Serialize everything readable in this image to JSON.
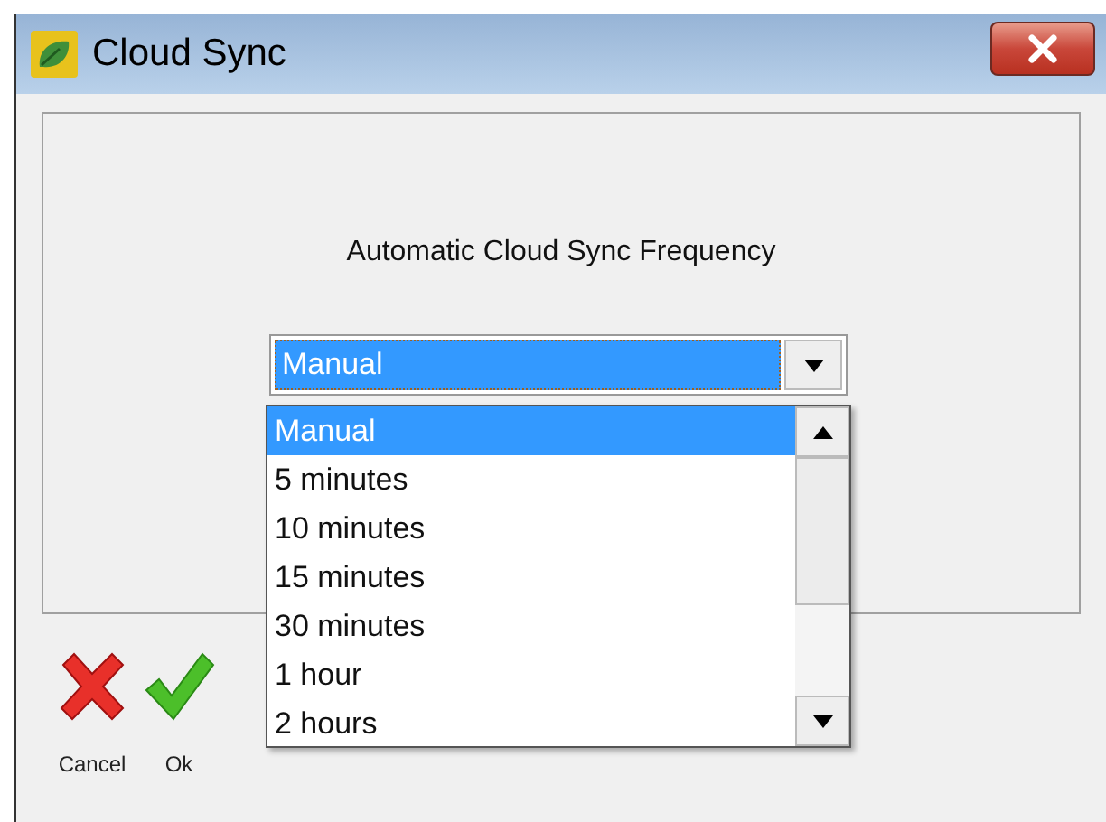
{
  "window": {
    "title": "Cloud Sync"
  },
  "frequency": {
    "label": "Automatic Cloud Sync Frequency",
    "value": "Manual",
    "expanded": true,
    "options": [
      {
        "label": "Manual",
        "selected": true
      },
      {
        "label": "5 minutes",
        "selected": false
      },
      {
        "label": "10 minutes",
        "selected": false
      },
      {
        "label": "15 minutes",
        "selected": false
      },
      {
        "label": "30 minutes",
        "selected": false
      },
      {
        "label": "1 hour",
        "selected": false
      },
      {
        "label": "2 hours",
        "selected": false
      }
    ]
  },
  "buttons": [
    {
      "kind": "cancel",
      "label": "Cancel"
    },
    {
      "kind": "ok",
      "label": "Ok"
    }
  ]
}
